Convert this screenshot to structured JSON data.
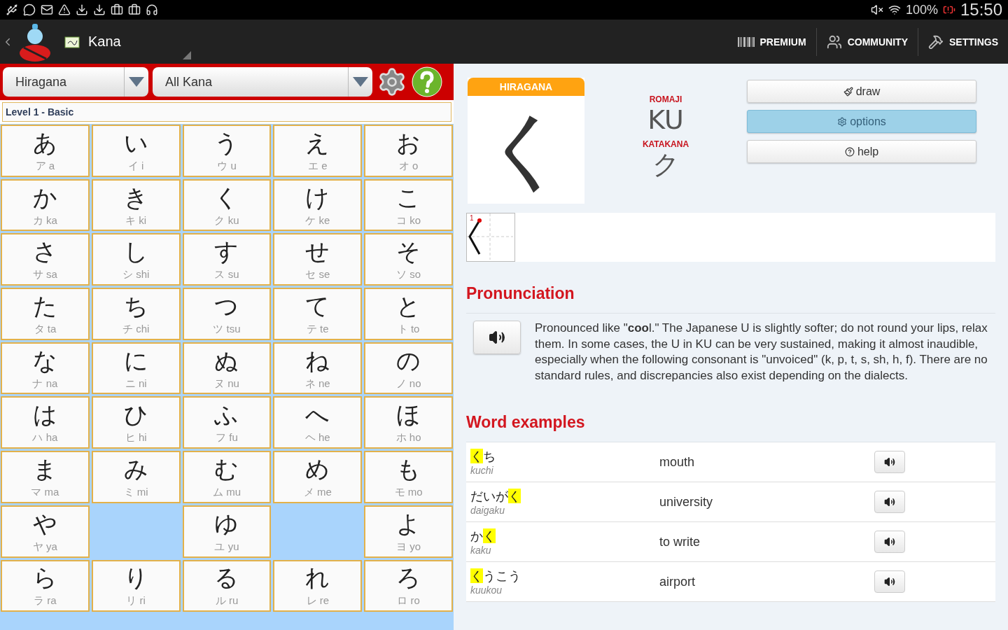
{
  "status_bar": {
    "battery": "100%",
    "time": "15:50"
  },
  "app_bar": {
    "title": "Kana",
    "actions": [
      {
        "kind": "premium",
        "label": "PREMIUM"
      },
      {
        "kind": "community",
        "label": "COMMUNITY"
      },
      {
        "kind": "settings",
        "label": "SETTINGS"
      }
    ]
  },
  "toolbar": {
    "script_select": "Hiragana",
    "set_select": "All Kana"
  },
  "level": "Level 1 - Basic",
  "grid": [
    [
      {
        "kana": "あ",
        "sub": "ア a",
        "kind": "kana"
      },
      {
        "kana": "い",
        "sub": "イ i",
        "kind": "kana"
      },
      {
        "kana": "う",
        "sub": "ウ u",
        "kind": "kana"
      },
      {
        "kana": "え",
        "sub": "エ e",
        "kind": "kana"
      },
      {
        "kana": "お",
        "sub": "オ o",
        "kind": "kana"
      }
    ],
    [
      {
        "kana": "か",
        "sub": "カ ka",
        "kind": "kana"
      },
      {
        "kana": "き",
        "sub": "キ ki",
        "kind": "kana"
      },
      {
        "kana": "く",
        "sub": "ク ku",
        "kind": "kana"
      },
      {
        "kana": "け",
        "sub": "ケ ke",
        "kind": "kana"
      },
      {
        "kana": "こ",
        "sub": "コ ko",
        "kind": "kana"
      }
    ],
    [
      {
        "kana": "さ",
        "sub": "サ sa",
        "kind": "kana"
      },
      {
        "kana": "し",
        "sub": "シ shi",
        "kind": "kana"
      },
      {
        "kana": "す",
        "sub": "ス su",
        "kind": "kana"
      },
      {
        "kana": "せ",
        "sub": "セ se",
        "kind": "kana"
      },
      {
        "kana": "そ",
        "sub": "ソ so",
        "kind": "kana"
      }
    ],
    [
      {
        "kana": "た",
        "sub": "タ ta",
        "kind": "kana"
      },
      {
        "kana": "ち",
        "sub": "チ chi",
        "kind": "kana"
      },
      {
        "kana": "つ",
        "sub": "ツ tsu",
        "kind": "kana"
      },
      {
        "kana": "て",
        "sub": "テ te",
        "kind": "kana"
      },
      {
        "kana": "と",
        "sub": "ト to",
        "kind": "kana"
      }
    ],
    [
      {
        "kana": "な",
        "sub": "ナ na",
        "kind": "kana"
      },
      {
        "kana": "に",
        "sub": "ニ ni",
        "kind": "kana"
      },
      {
        "kana": "ぬ",
        "sub": "ヌ nu",
        "kind": "kana"
      },
      {
        "kana": "ね",
        "sub": "ネ ne",
        "kind": "kana"
      },
      {
        "kana": "の",
        "sub": "ノ no",
        "kind": "kana"
      }
    ],
    [
      {
        "kana": "は",
        "sub": "ハ ha",
        "kind": "kana"
      },
      {
        "kana": "ひ",
        "sub": "ヒ hi",
        "kind": "kana"
      },
      {
        "kana": "ふ",
        "sub": "フ fu",
        "kind": "kana"
      },
      {
        "kana": "へ",
        "sub": "ヘ he",
        "kind": "kana"
      },
      {
        "kana": "ほ",
        "sub": "ホ ho",
        "kind": "kana"
      }
    ],
    [
      {
        "kana": "ま",
        "sub": "マ ma",
        "kind": "kana"
      },
      {
        "kana": "み",
        "sub": "ミ mi",
        "kind": "kana"
      },
      {
        "kana": "む",
        "sub": "ム mu",
        "kind": "kana"
      },
      {
        "kana": "め",
        "sub": "メ me",
        "kind": "kana"
      },
      {
        "kana": "も",
        "sub": "モ mo",
        "kind": "kana"
      }
    ],
    [
      {
        "kana": "や",
        "sub": "ヤ ya",
        "kind": "kana"
      },
      {
        "kind": "empty"
      },
      {
        "kana": "ゆ",
        "sub": "ユ yu",
        "kind": "kana"
      },
      {
        "kind": "empty"
      },
      {
        "kana": "よ",
        "sub": "ヨ yo",
        "kind": "kana"
      }
    ],
    [
      {
        "kana": "ら",
        "sub": "ラ ra",
        "kind": "kana"
      },
      {
        "kana": "り",
        "sub": "リ ri",
        "kind": "kana"
      },
      {
        "kana": "る",
        "sub": "ル ru",
        "kind": "kana"
      },
      {
        "kana": "れ",
        "sub": "レ re",
        "kind": "kana"
      },
      {
        "kana": "ろ",
        "sub": "ロ ro",
        "kind": "kana"
      }
    ]
  ],
  "detail": {
    "script_label": "HIRAGANA",
    "kana": "く",
    "romaji_label": "ROMAJI",
    "romaji": "KU",
    "katakana_label": "KATAKANA",
    "katakana": "ク",
    "buttons": [
      {
        "kind": "draw",
        "label": "draw",
        "selected": false
      },
      {
        "kind": "options",
        "label": "options",
        "selected": true
      },
      {
        "kind": "help",
        "label": "help",
        "selected": false
      }
    ],
    "stroke_number": "1"
  },
  "pronunciation": {
    "heading": "Pronunciation",
    "text": "Pronounced like \"**coo**l.\" The Japanese U is slightly softer; do not round your lips, relax them. In some cases, the U in KU can be very sustained, making it almost inaudible, especially when the following consonant is \"unvoiced\" (k, p, t, s, sh, h, f). There are no standard rules, and discrepancies also exist depending on the dialects."
  },
  "word_examples": {
    "heading": "Word examples",
    "rows": [
      {
        "parts": [
          {
            "text": "く",
            "highlight": true
          },
          {
            "text": "ち",
            "highlight": false
          }
        ],
        "reading": "kuchi",
        "meaning": "mouth"
      },
      {
        "parts": [
          {
            "text": "だいが",
            "highlight": false
          },
          {
            "text": "く",
            "highlight": true
          }
        ],
        "reading": "daigaku",
        "meaning": "university"
      },
      {
        "parts": [
          {
            "text": "か",
            "highlight": false
          },
          {
            "text": "く",
            "highlight": true
          }
        ],
        "reading": "kaku",
        "meaning": "to write"
      },
      {
        "parts": [
          {
            "text": "く",
            "highlight": true
          },
          {
            "text": "うこう",
            "highlight": false
          }
        ],
        "reading": "kuukou",
        "meaning": "airport"
      }
    ]
  }
}
